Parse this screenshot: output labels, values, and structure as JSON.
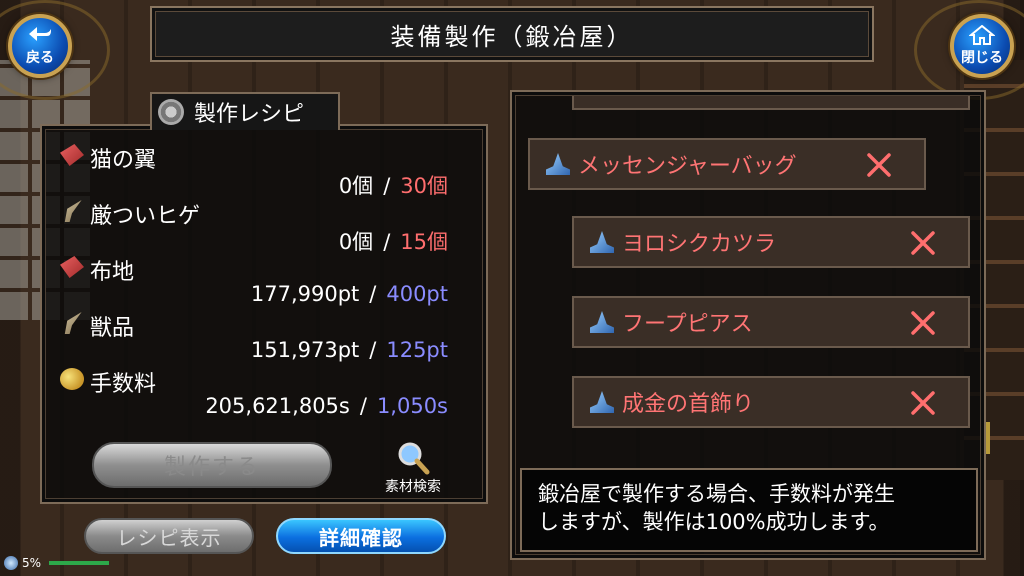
{
  "header": {
    "title": "装備製作（鍛冶屋）",
    "back_label": "戻る",
    "close_label": "閉じる"
  },
  "recipe_panel": {
    "title": "製作レシピ",
    "materials": [
      {
        "name": "猫の翼",
        "owned": "0個",
        "required": "30個",
        "icon": "red-wing-icon",
        "required_color": "#ff6e6e"
      },
      {
        "name": "厳ついヒゲ",
        "owned": "0個",
        "required": "15個",
        "icon": "claw-icon",
        "required_color": "#ff6e6e"
      },
      {
        "name": "布地",
        "owned": "177,990pt",
        "required": "400pt",
        "icon": "red-wing-icon",
        "required_color": "#8a8cff"
      },
      {
        "name": "獣品",
        "owned": "151,973pt",
        "required": "125pt",
        "icon": "claw-icon",
        "required_color": "#8a8cff"
      },
      {
        "name": "手数料",
        "owned": "205,621,805s",
        "required": "1,050s",
        "icon": "coin-icon",
        "required_color": "#8a8cff"
      }
    ],
    "separator": "/",
    "craft_label": "製作する",
    "search_label": "素材検索"
  },
  "tabs": {
    "recipe_label": "レシピ表示",
    "detail_label": "詳細確認"
  },
  "recipe_list": [
    {
      "name": "メッセンジャーバッグ",
      "icon": "wizard-hat-icon"
    },
    {
      "name": "ヨロシクカツラ",
      "icon": "wizard-hat-icon"
    },
    {
      "name": "フープピアス",
      "icon": "wizard-hat-icon"
    },
    {
      "name": "成金の首飾り",
      "icon": "wizard-hat-icon"
    }
  ],
  "help_text_line1": "鍛冶屋で製作する場合、手数料が発生",
  "help_text_line2": "しますが、製作は100%成功します。",
  "status": {
    "battery": "5%"
  },
  "colors": {
    "accent_red": "#ff6e6e",
    "accent_blue": "#8a8cff",
    "button_blue": "#0b6fe0"
  }
}
